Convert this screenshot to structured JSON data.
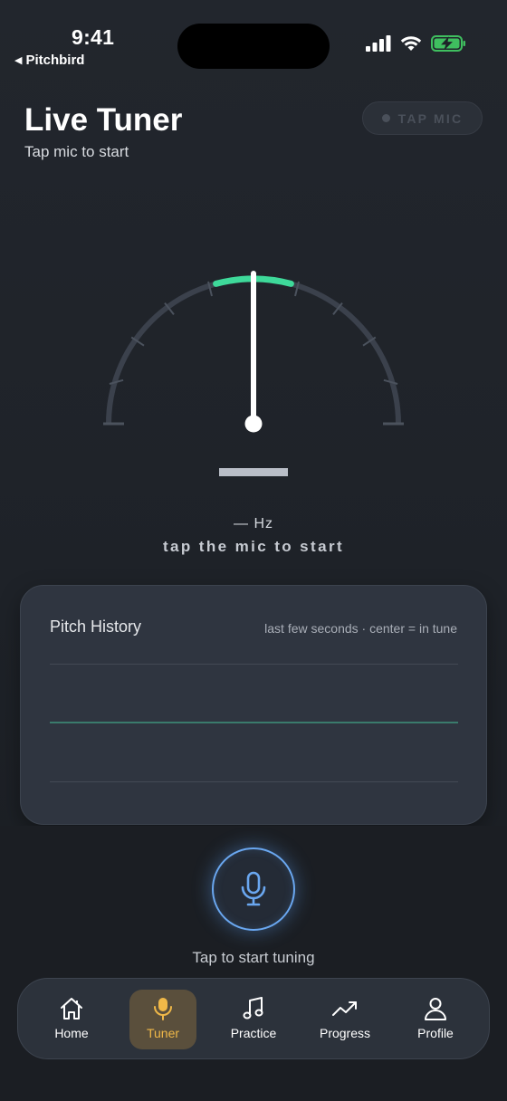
{
  "status_bar": {
    "time": "9:41",
    "back_label": "Pitchbird"
  },
  "header": {
    "title": "Live Tuner",
    "subtitle": "Tap mic to start",
    "mic_pill_label": "TAP MIC"
  },
  "tuner": {
    "frequency": "— Hz",
    "hint": "tap the mic to start",
    "needle_cents": 0
  },
  "history": {
    "title": "Pitch History",
    "note": "last few seconds · center = in tune"
  },
  "mic": {
    "caption": "Tap to start tuning"
  },
  "tabs": [
    {
      "label": "Home",
      "icon": "home-icon",
      "active": false
    },
    {
      "label": "Tuner",
      "icon": "mic-icon",
      "active": true
    },
    {
      "label": "Practice",
      "icon": "music-note-icon",
      "active": false
    },
    {
      "label": "Progress",
      "icon": "trending-up-icon",
      "active": false
    },
    {
      "label": "Profile",
      "icon": "profile-icon",
      "active": false
    }
  ],
  "colors": {
    "background": "#1e2228",
    "in_tune_arc": "#3ed99a",
    "mic_accent": "#6aa7f0",
    "active_tab": "#f0b848"
  }
}
